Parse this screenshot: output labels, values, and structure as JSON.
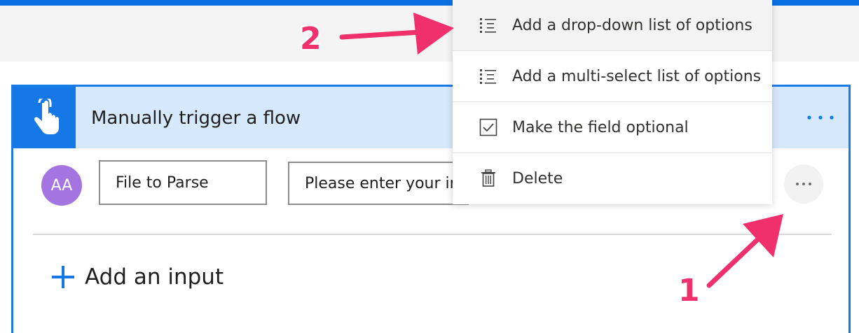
{
  "card": {
    "title": "Manually trigger a flow",
    "trigger_icon": "touch-hand-icon",
    "more_icon": "more-horizontal-icon"
  },
  "input_row": {
    "avatar_text": "AA",
    "field_name": "File to Parse",
    "placeholder_text": "Please enter your in",
    "more_icon": "more-horizontal-icon"
  },
  "add_input": {
    "icon": "plus-icon",
    "label": "Add an input"
  },
  "context_menu": {
    "items": [
      {
        "label": "Add a drop-down list of options",
        "icon": "list-icon",
        "highlighted": true
      },
      {
        "label": "Add a multi-select list of options",
        "icon": "list-icon",
        "highlighted": false
      },
      {
        "label": "Make the field optional",
        "icon": "checkbox-icon",
        "highlighted": false
      },
      {
        "label": "Delete",
        "icon": "trash-icon",
        "highlighted": false
      }
    ]
  },
  "annotations": {
    "label_1": "1",
    "label_2": "2",
    "color": "#f0306c"
  },
  "colors": {
    "accent": "#1677e6",
    "header_bg": "#d6e8fb",
    "avatar_bg": "#a474e0"
  }
}
